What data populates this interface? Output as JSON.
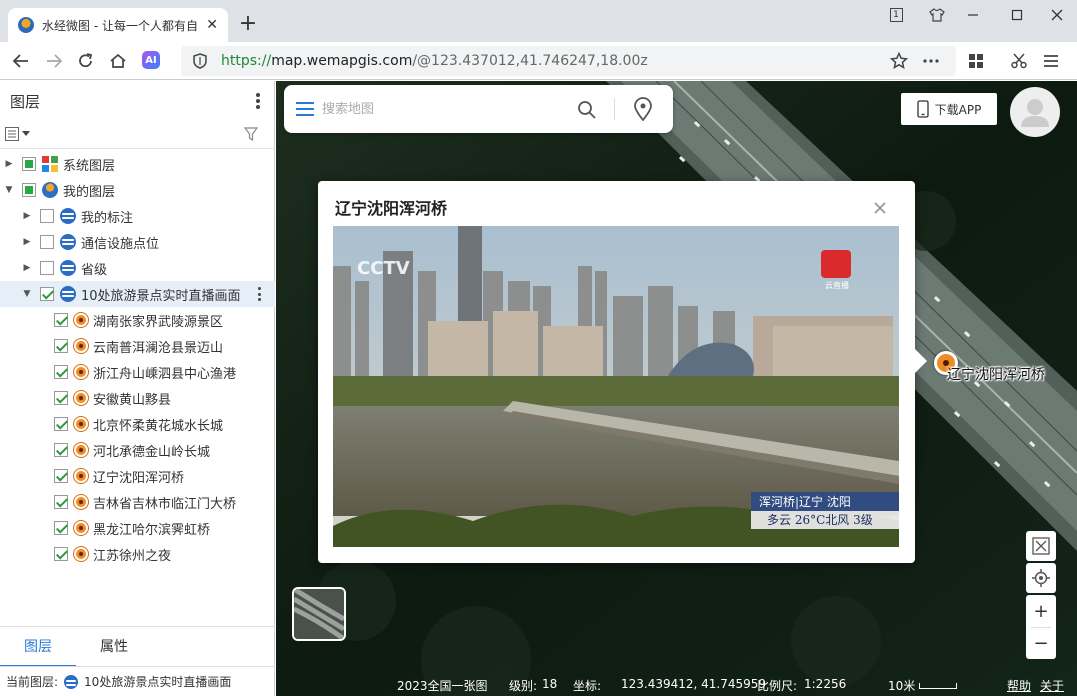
{
  "browser": {
    "tab_title": "水经微图 - 让每一个人都有自",
    "url_scheme": "https://",
    "url_host": "map.wemapgis.com",
    "url_path": "/@123.437012,41.746247,18.00z",
    "window_num": "1",
    "ai_label": "AI"
  },
  "panel": {
    "title": "图层",
    "tree": [
      {
        "label": "系统图层",
        "check": "partial",
        "icon": "system-layer-icon",
        "level": 0
      },
      {
        "label": "我的图层",
        "check": "partial",
        "icon": "globe-icon",
        "level": 0
      },
      {
        "label": "我的标注",
        "check": "none",
        "icon": "layer-icon",
        "level": 1
      },
      {
        "label": "通信设施点位",
        "check": "none",
        "icon": "layer-icon",
        "level": 1
      },
      {
        "label": "省级",
        "check": "none",
        "icon": "layer-icon",
        "level": 1
      },
      {
        "label": "10处旅游景点实时直播画面",
        "check": "checked",
        "icon": "layer-icon",
        "level": 1
      },
      {
        "label": "湖南张家界武陵源景区",
        "check": "checked",
        "icon": "point-icon",
        "level": 2
      },
      {
        "label": "云南普洱澜沧县景迈山",
        "check": "checked",
        "icon": "point-icon",
        "level": 2
      },
      {
        "label": "浙江舟山嵊泗县中心渔港",
        "check": "checked",
        "icon": "point-icon",
        "level": 2
      },
      {
        "label": "安徽黄山黟县",
        "check": "checked",
        "icon": "point-icon",
        "level": 2
      },
      {
        "label": "北京怀柔黄花城水长城",
        "check": "checked",
        "icon": "point-icon",
        "level": 2
      },
      {
        "label": "河北承德金山岭长城",
        "check": "checked",
        "icon": "point-icon",
        "level": 2
      },
      {
        "label": "辽宁沈阳浑河桥",
        "check": "checked",
        "icon": "point-icon",
        "level": 2
      },
      {
        "label": "吉林省吉林市临江门大桥",
        "check": "checked",
        "icon": "point-icon",
        "level": 2
      },
      {
        "label": "黑龙江哈尔滨霁虹桥",
        "check": "checked",
        "icon": "point-icon",
        "level": 2
      },
      {
        "label": "江苏徐州之夜",
        "check": "checked",
        "icon": "point-icon",
        "level": 2
      }
    ],
    "tabs": [
      "图层",
      "属性"
    ],
    "current_layer_label": "当前图层:",
    "current_layer": "10处旅游景点实时直播画面"
  },
  "map": {
    "search_placeholder": "搜索地图",
    "download_label": "下载APP",
    "popup_title": "辽宁沈阳浑河桥",
    "marker_label": "辽宁沈阳浑河桥",
    "video_overlay": {
      "station_logo": "CCTV",
      "channel_badge": "云直播",
      "location": "浑河桥|辽宁 沈阳",
      "weather": "多云 26°C北风 3级"
    },
    "status": {
      "basemap": "2023全国一张图",
      "zoom_label": "级别:",
      "zoom": "18",
      "coord_label": "坐标:",
      "coord": "123.439412, 41.745959",
      "scale_label": "比例尺:",
      "scale": "1:2256",
      "scale_bar": "10米",
      "help": "帮助",
      "about": "关于"
    }
  },
  "colors": {
    "accent": "#2a7ad8",
    "check_green": "#2a9a3a",
    "marker_orange": "#f08a24",
    "url_green": "#1a8a3a"
  }
}
